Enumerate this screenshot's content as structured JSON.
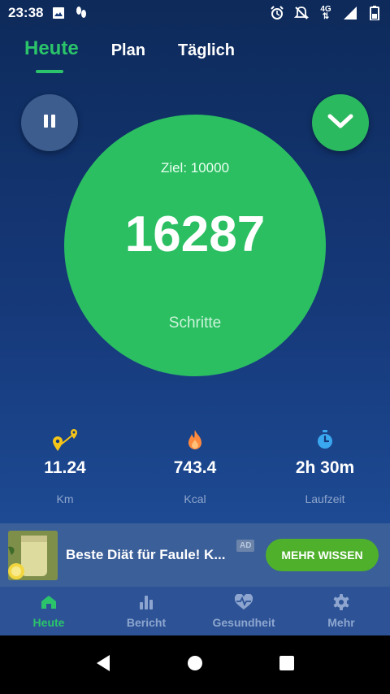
{
  "status_bar": {
    "time": "23:38",
    "left_icons": [
      "image-icon",
      "footsteps-icon"
    ],
    "right_icons": [
      "alarm-icon",
      "notifications-off-icon",
      "network-4g-icon",
      "signal-icon",
      "battery-icon"
    ],
    "network_label": "4G"
  },
  "tabs": [
    {
      "label": "Heute",
      "active": true
    },
    {
      "label": "Plan",
      "active": false
    },
    {
      "label": "Täglich",
      "active": false
    }
  ],
  "controls": {
    "pause_icon": "pause-icon",
    "collapse_icon": "chevron-down-icon"
  },
  "steps": {
    "goal": "Ziel: 10000",
    "count": "16287",
    "label": "Schritte"
  },
  "stats": [
    {
      "icon": "map-pin-route-icon",
      "value": "11.24",
      "label": "Km",
      "color": "#f5c518"
    },
    {
      "icon": "flame-icon",
      "value": "743.4",
      "label": "Kcal",
      "color": "#ff8a3d"
    },
    {
      "icon": "stopwatch-icon",
      "value": "2h 30m",
      "label": "Laufzeit",
      "color": "#3aa8f0"
    }
  ],
  "ad": {
    "title": "Beste Diät für Faule! K...",
    "badge": "AD",
    "cta": "MEHR WISSEN"
  },
  "bottom_nav": [
    {
      "label": "Heute",
      "icon": "home-icon",
      "active": true
    },
    {
      "label": "Bericht",
      "icon": "bar-chart-icon",
      "active": false
    },
    {
      "label": "Gesundheit",
      "icon": "heartbeat-icon",
      "active": false
    },
    {
      "label": "Mehr",
      "icon": "gear-icon",
      "active": false
    }
  ],
  "colors": {
    "accent_green": "#2bbf62",
    "background_top": "#0d2a5a",
    "nav_inactive": "#8ea6cf"
  }
}
